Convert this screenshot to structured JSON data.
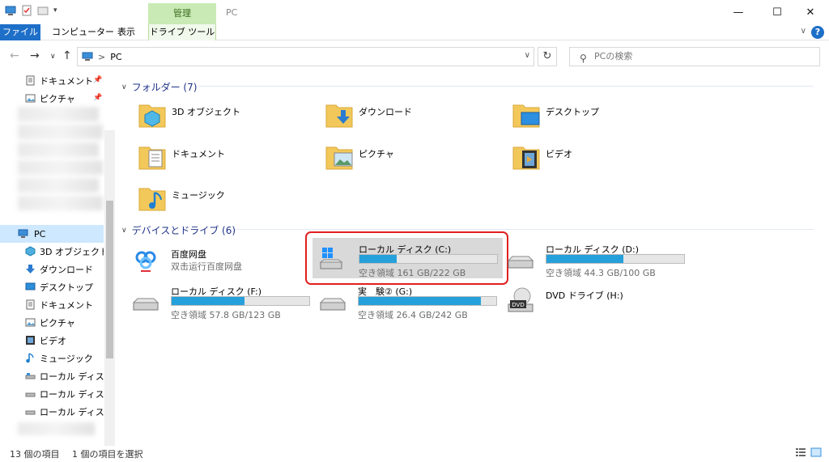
{
  "window": {
    "title": "PC",
    "context_tab_group": "管理",
    "minimize": "—",
    "maximize": "☐",
    "close": "✕"
  },
  "ribbon": {
    "tabs": [
      {
        "label": "ファイル"
      },
      {
        "label": "コンピューター"
      },
      {
        "label": "表示"
      },
      {
        "label": "ドライブ ツール"
      }
    ],
    "help": "?"
  },
  "address": {
    "path": "PC",
    "separator": ">",
    "search_placeholder": "PCの検索"
  },
  "sidebar": {
    "pinned": [
      {
        "label": "ドキュメント",
        "icon": "documents-icon"
      },
      {
        "label": "ピクチャ",
        "icon": "pictures-icon"
      }
    ],
    "pc_label": "PC",
    "pc_children": [
      {
        "label": "3D オブジェクト",
        "icon": "3d-objects-icon"
      },
      {
        "label": "ダウンロード",
        "icon": "downloads-icon"
      },
      {
        "label": "デスクトップ",
        "icon": "desktop-icon"
      },
      {
        "label": "ドキュメント",
        "icon": "documents-icon"
      },
      {
        "label": "ピクチャ",
        "icon": "pictures-icon"
      },
      {
        "label": "ビデオ",
        "icon": "videos-icon"
      },
      {
        "label": "ミュージック",
        "icon": "music-icon"
      },
      {
        "label": "ローカル ディスク (C",
        "icon": "drive-icon"
      },
      {
        "label": "ローカル ディスク (D",
        "icon": "drive-icon"
      },
      {
        "label": "ローカル ディスク (F",
        "icon": "drive-icon"
      }
    ]
  },
  "folders_section": {
    "title": "フォルダー (7)",
    "items": [
      {
        "label": "3D オブジェクト",
        "icon": "3d-objects-folder-icon"
      },
      {
        "label": "ダウンロード",
        "icon": "downloads-folder-icon"
      },
      {
        "label": "デスクトップ",
        "icon": "desktop-folder-icon"
      },
      {
        "label": "ドキュメント",
        "icon": "documents-folder-icon"
      },
      {
        "label": "ピクチャ",
        "icon": "pictures-folder-icon"
      },
      {
        "label": "ビデオ",
        "icon": "videos-folder-icon"
      },
      {
        "label": "ミュージック",
        "icon": "music-folder-icon"
      }
    ]
  },
  "devices_section": {
    "title": "デバイスとドライブ (6)",
    "baidu": {
      "name": "百度网盘",
      "subtitle": "双击运行百度网盘"
    },
    "drives": [
      {
        "name": "ローカル ディスク (C:)",
        "free": "空き領域 161 GB/222 GB",
        "used_fraction": 0.27
      },
      {
        "name": "ローカル ディスク (D:)",
        "free": "空き領域 44.3 GB/100 GB",
        "used_fraction": 0.56
      },
      {
        "name": "ローカル ディスク (F:)",
        "free": "空き領域 57.8 GB/123 GB",
        "used_fraction": 0.53
      },
      {
        "name": "実　験② (G:)",
        "free": "空き領域 26.4 GB/242 GB",
        "used_fraction": 0.89
      }
    ],
    "dvd": {
      "name": "DVD ドライブ (H:)",
      "badge": "DVD"
    }
  },
  "status": {
    "count": "13 個の項目",
    "selected": "1 個の項目を選択"
  },
  "colors": {
    "accent": "#1e6fc8",
    "bar_fill": "#26a0da",
    "selection_outline": "#e0201f"
  }
}
